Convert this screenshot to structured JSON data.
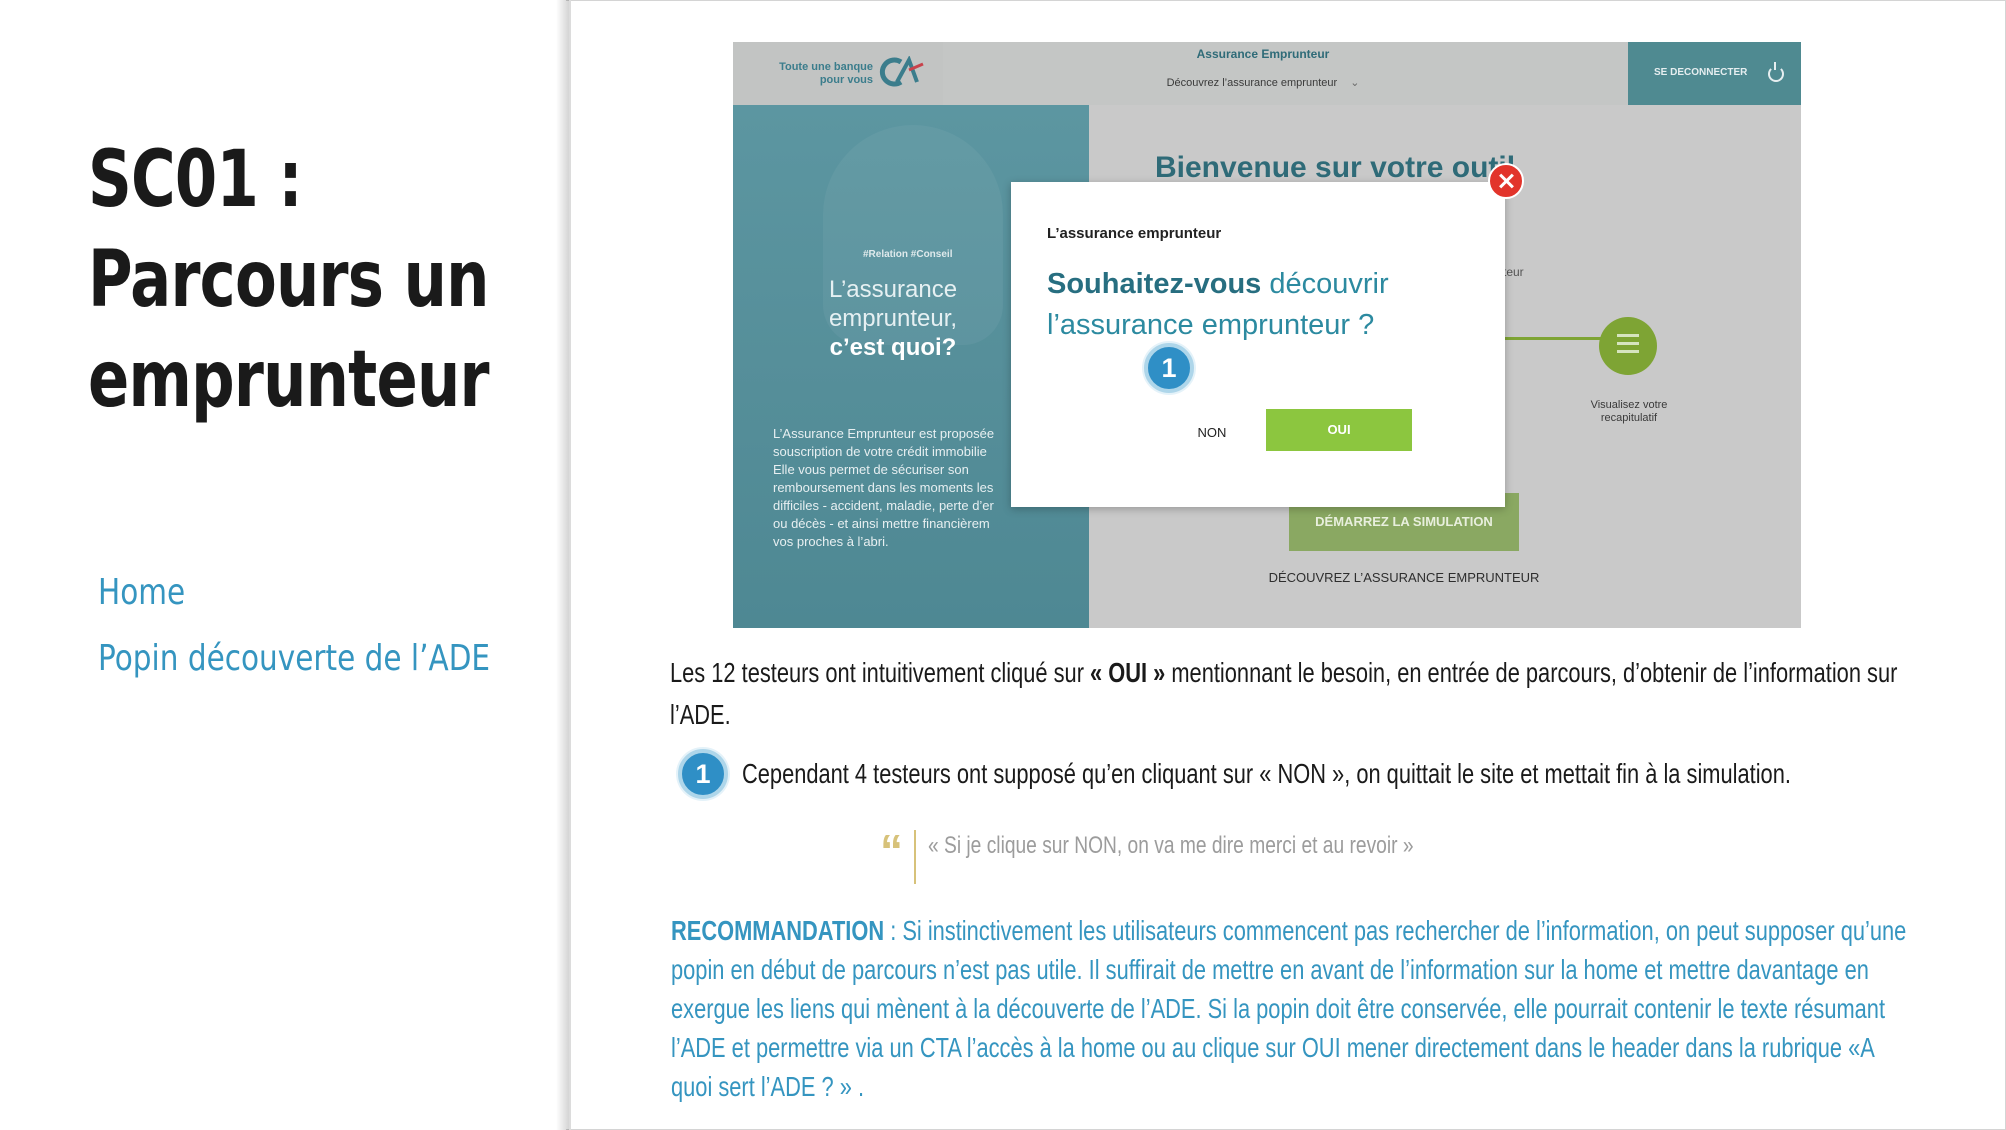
{
  "slide": {
    "title_lines": [
      "SC01 :",
      "Parcours un",
      "emprunteur"
    ],
    "nav": {
      "home": "Home",
      "popin": "Popin découverte de l’ADE"
    }
  },
  "mockup": {
    "header": {
      "logo_text_line1": "Toute une banque",
      "logo_text_line2": "pour vous",
      "title": "Assurance Emprunteur",
      "subtitle": "Découvrez l’assurance emprunteur",
      "logout": "SE DECONNECTER"
    },
    "hero": {
      "tag": "#Relation #Conseil",
      "title_line1": "L’assurance",
      "title_line2": "emprunteur,",
      "title_bold": "c’est quoi?",
      "body": "L’Assurance Emprunteur est proposée\nsouscription de votre crédit immobilie\nElle vous permet de sécuriser son\nremboursement dans les moments les\ndifficiles - accident, maladie, perte d’er\nou décès - et ainsi mettre financièrem\nvos proches à l’abri."
    },
    "main": {
      "welcome": "Bienvenue sur votre outil",
      "bg_fragment": "teur",
      "step_label": "Visualisez votre\nrecapitulatif",
      "start_button": "DÉMARREZ LA SIMULATION",
      "discover_link": "DÉCOUVREZ L’ASSURANCE EMPRUNTEUR"
    },
    "modal": {
      "eyebrow": "L’assurance emprunteur",
      "question_strong": "Souhaitez-vous",
      "question_rest": " découvrir l’assurance emprunteur ?",
      "no_label": "NON",
      "yes_label": "OUI"
    },
    "badge_number": "1"
  },
  "findings": {
    "para_part1": "Les 12 testeurs ont intuitivement cliqué sur ",
    "para_strong": "« OUI »",
    "para_part2": " mentionnant le besoin, en entrée de parcours, d’obtenir de l’information sur l’ADE.",
    "badge_number": "1",
    "item": "Cependant 4 testeurs ont supposé qu’en cliquant sur « NON », on quittait le site et mettait fin à la simulation.",
    "quote": "« Si je clique sur NON, on va me dire merci et au revoir »",
    "reco_label": "RECOMMANDATION",
    "reco_text": " : Si instinctivement les utilisateurs commencent pas rechercher de l’information, on peut supposer qu’une popin en début de parcours n’est pas utile. Il suffirait de mettre en avant de l’information sur la home et mettre davantage en exergue les liens qui mènent à la découverte de l’ADE. Si la popin doit être conservée, elle pourrait contenir le texte résumant l’ADE et permettre via un CTA l’accès à la home ou au clique sur OUI mener directement dans le header dans la rubrique  «A quoi sert l’ADE ? » ."
  },
  "colors": {
    "accent_blue": "#3595c0",
    "teal": "#2f6b78",
    "green": "#8cc63f",
    "close_red": "#e2342b",
    "quote_gold": "#d7c27a"
  }
}
